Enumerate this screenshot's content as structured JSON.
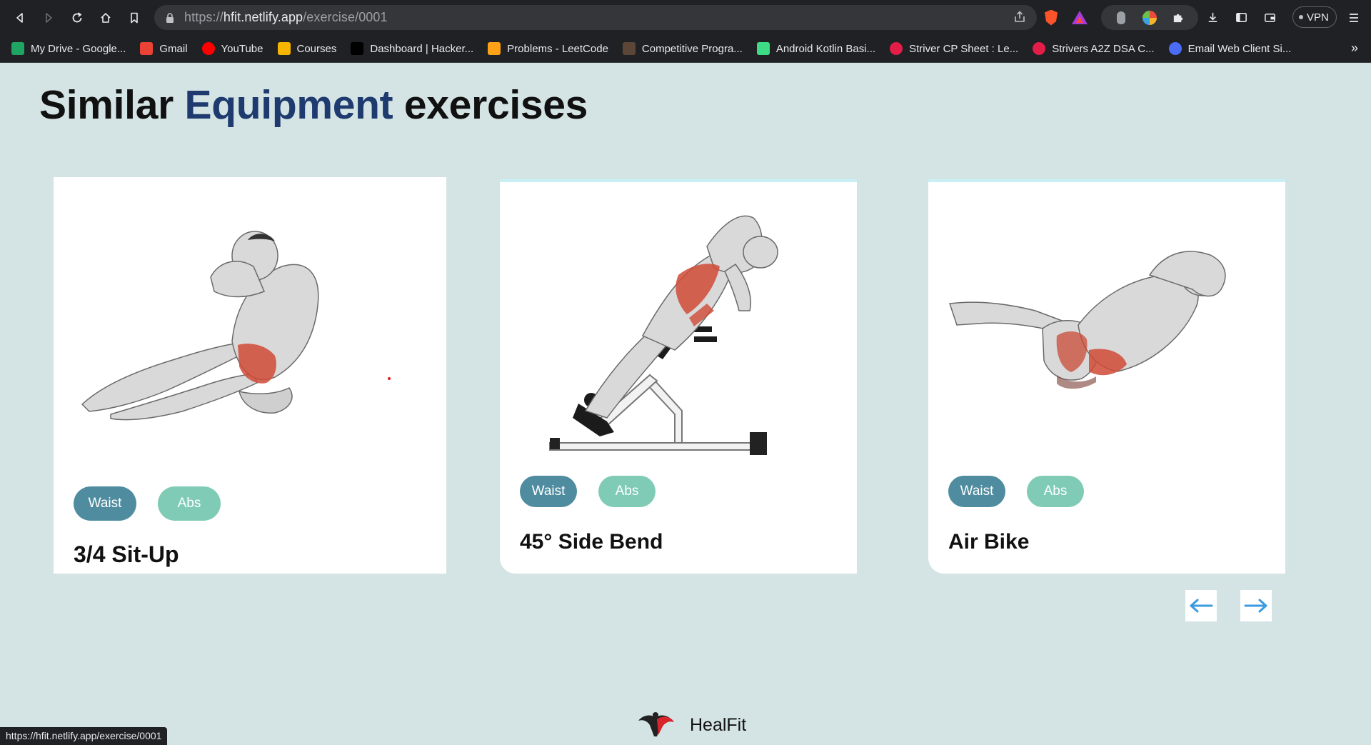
{
  "browser": {
    "url_scheme": "https://",
    "url_host": "hfit.netlify.app",
    "url_path": "/exercise/0001",
    "vpn_label": "VPN",
    "bookmarks": [
      {
        "label": "My Drive - Google...",
        "icon": "google-drive-icon",
        "color": "#1fa463"
      },
      {
        "label": "Gmail",
        "icon": "gmail-icon",
        "color": "#ea4335"
      },
      {
        "label": "YouTube",
        "icon": "youtube-icon",
        "color": "#ff0000"
      },
      {
        "label": "Courses",
        "icon": "courses-icon",
        "color": "#f4b400"
      },
      {
        "label": "Dashboard | Hacker...",
        "icon": "hackerrank-icon",
        "color": "#000000"
      },
      {
        "label": "Problems - LeetCode",
        "icon": "leetcode-icon",
        "color": "#ffa116"
      },
      {
        "label": "Competitive Progra...",
        "icon": "codechef-icon",
        "color": "#5b4638"
      },
      {
        "label": "Android Kotlin Basi...",
        "icon": "android-icon",
        "color": "#3ddc84"
      },
      {
        "label": "Striver CP Sheet : Le...",
        "icon": "tuf-icon",
        "color": "#e11d48"
      },
      {
        "label": "Strivers A2Z DSA C...",
        "icon": "tuf-icon",
        "color": "#e11d48"
      },
      {
        "label": "Email Web Client Si...",
        "icon": "email-client-icon",
        "color": "#4a6cf7"
      }
    ],
    "status_url": "https://hfit.netlify.app/exercise/0001"
  },
  "page": {
    "heading_part1": "Similar ",
    "heading_accent": "Equipment",
    "heading_part2": " exercises",
    "accent_color": "#1e3a6e",
    "cards": [
      {
        "title": "3/4 Sit-Up",
        "tags": [
          "Waist",
          "Abs"
        ],
        "image": "situp-figure-illustration"
      },
      {
        "title": "45° Side Bend",
        "tags": [
          "Waist",
          "Abs"
        ],
        "image": "side-bend-bench-illustration"
      },
      {
        "title": "Air Bike",
        "tags": [
          "Waist",
          "Abs"
        ],
        "image": "air-bike-figure-illustration"
      }
    ],
    "prev_icon": "arrow-left-icon",
    "next_icon": "arrow-right-icon",
    "footer_brand": "HealFit"
  }
}
